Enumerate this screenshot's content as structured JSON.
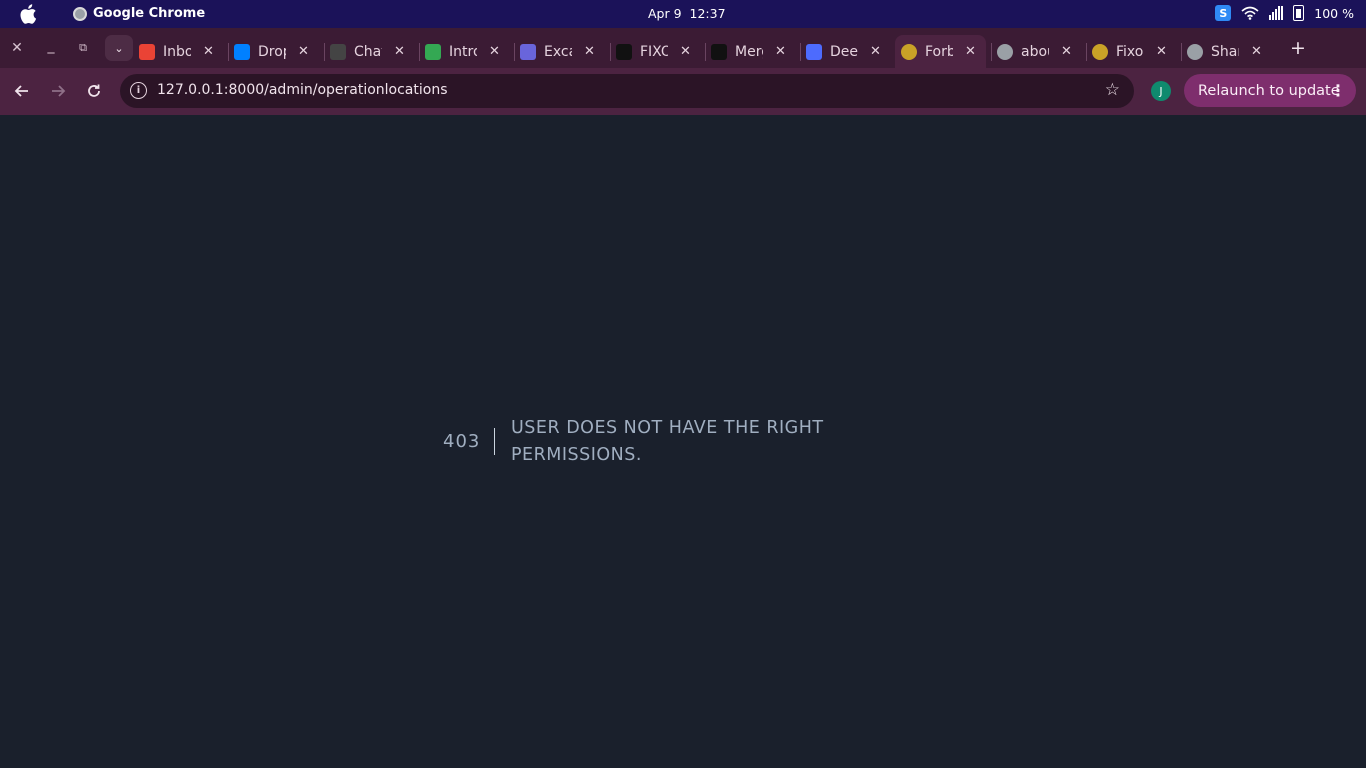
{
  "os_bar": {
    "app_name": "Google Chrome",
    "date": "Apr 9",
    "time": "12:37",
    "battery": "100 %"
  },
  "tabs": [
    {
      "title": "Inbox",
      "icon": "gmail-icon",
      "color": "#ea4335"
    },
    {
      "title": "Drop",
      "icon": "digitalocean-icon",
      "color": "#0080ff"
    },
    {
      "title": "Chat",
      "icon": "openai-icon",
      "color": "#444444"
    },
    {
      "title": "Intro",
      "icon": "sheets-icon",
      "color": "#34a853"
    },
    {
      "title": "Excal",
      "icon": "excalidraw-icon",
      "color": "#6965db"
    },
    {
      "title": "FIXO",
      "icon": "notion-icon",
      "color": "#111111"
    },
    {
      "title": "Merge",
      "icon": "github-icon",
      "color": "#111111"
    },
    {
      "title": "Deep",
      "icon": "deepseek-icon",
      "color": "#4d6bfe"
    },
    {
      "title": "Forbidden",
      "icon": "laravel-icon",
      "color": "#c9a227"
    },
    {
      "title": "about",
      "icon": "globe-icon",
      "color": "#9aa0a6"
    },
    {
      "title": "Fixo",
      "icon": "laravel-icon",
      "color": "#c9a227"
    },
    {
      "title": "Share",
      "icon": "globe-icon",
      "color": "#9aa0a6"
    }
  ],
  "toolbar": {
    "url": "127.0.0.1:8000/admin/operationlocations",
    "profile_initial": "J",
    "relaunch_label": "Relaunch to update"
  },
  "error": {
    "code": "403",
    "message": "USER DOES NOT HAVE THE RIGHT PERMISSIONS."
  },
  "colors": {
    "page_bg": "#1a202c",
    "error_text": "#a0aec0",
    "toolbar_bg": "#4c2341",
    "relaunch_bg": "#7e2e6d"
  }
}
